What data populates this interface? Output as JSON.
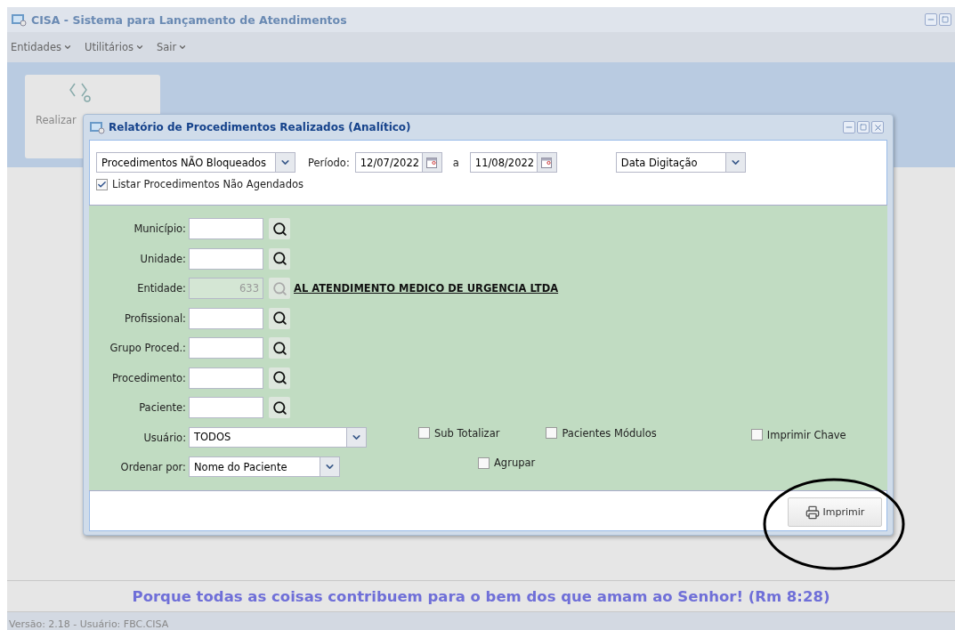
{
  "window": {
    "title": "CISA - Sistema para Lançamento de Atendimentos"
  },
  "menu": [
    {
      "label": "Entidades"
    },
    {
      "label": "Utilitários"
    },
    {
      "label": "Sair"
    }
  ],
  "tiles": [
    {
      "label": "Realizar"
    }
  ],
  "dialog": {
    "title": "Relatório de Procedimentos Realizados (Analítico)",
    "filter_select": {
      "value": "Procedimentos NÃO Bloqueados"
    },
    "period_label": "Período:",
    "date_from": {
      "value": "12/07/2022"
    },
    "date_separator": "a",
    "date_to": {
      "value": "11/08/2022"
    },
    "date_type": {
      "value": "Data Digitação"
    },
    "list_unscheduled": {
      "label": "Listar Procedimentos Não Agendados",
      "checked": true
    },
    "fields": [
      {
        "label": "Município:",
        "disabled": false
      },
      {
        "label": "Unidade:",
        "disabled": false
      },
      {
        "label": "Entidade:",
        "value": "633",
        "disabled": true,
        "link": "AL ATENDIMENTO MEDICO DE URGENCIA LTDA"
      },
      {
        "label": "Profissional:",
        "disabled": false
      },
      {
        "label": "Grupo Proced.:",
        "disabled": false
      },
      {
        "label": "Procedimento:",
        "disabled": false
      },
      {
        "label": "Paciente:",
        "disabled": false
      }
    ],
    "user": {
      "label": "Usuário:",
      "value": "TODOS"
    },
    "order": {
      "label": "Ordenar por:",
      "value": "Nome do Paciente"
    },
    "options": [
      {
        "label": "Sub Totalizar",
        "checked": false
      },
      {
        "label": "Pacientes Módulos",
        "checked": false
      },
      {
        "label": "Imprimir Chave",
        "checked": false
      },
      {
        "label": "Agrupar",
        "checked": false
      }
    ],
    "print_button": {
      "label": "Imprimir"
    }
  },
  "quote": "Porque todas as coisas contribuem para o bem dos que amam ao Senhor! (Rm 8:28)",
  "status_bar": "Versão: 2.18 - Usuário: FBC.CISA"
}
